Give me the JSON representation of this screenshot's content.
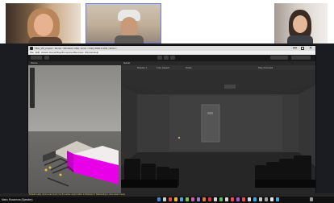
{
  "unity": {
    "title": "TEA_VR_project - Demo - Windows, Mac, Linux - Unity 2022.3.10f1 <DX11>",
    "menu": [
      "File",
      "Edit",
      "Assets",
      "GameObject",
      "Component",
      "Services",
      "Window",
      "Help"
    ],
    "scene_tab": "Scene",
    "game_tab": "Game",
    "game_display": "Display 1",
    "game_aspect": "Free Aspect",
    "game_scale": "Scale",
    "play_focused": "Play Focused",
    "status_message": "Default reality device was found, but the active output folder is Windows 8. Rebranding is done (learn more)"
  },
  "call": {
    "bottom_label": "Mario Rocamora (Speaker)"
  },
  "icons": [
    "unity-logo-icon",
    "play-icon",
    "pause-icon",
    "step-icon",
    "camera-icon",
    "chair-icon",
    "door-icon",
    "windows-start-icon",
    "search-icon",
    "browser-icon",
    "folder-icon",
    "mail-icon"
  ]
}
